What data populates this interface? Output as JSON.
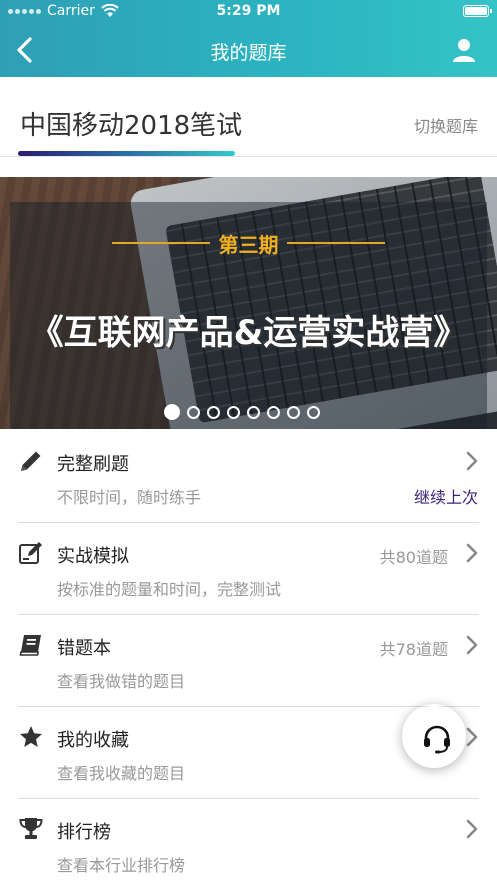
{
  "status_bar": {
    "carrier": "Carrier",
    "time": "5:29 PM"
  },
  "nav": {
    "title": "我的题库",
    "back_icon": "chevron-left-icon",
    "user_icon": "user-icon"
  },
  "bank": {
    "title": "中国移动2018笔试",
    "switch_label": "切换题库"
  },
  "banner": {
    "period": "第三期",
    "headline": "《互联网产品&运营实战营》",
    "page_count": 8,
    "active_page": 1
  },
  "menu": [
    {
      "name": "完整刷题",
      "desc": "不限时间，随时练手",
      "count": "",
      "extra": "继续上次",
      "icon": "pencil-icon"
    },
    {
      "name": "实战模拟",
      "desc": "按标准的题量和时间，完整测试",
      "count": "共80道题",
      "extra": "",
      "icon": "edit-note-icon"
    },
    {
      "name": "错题本",
      "desc": "查看我做错的题目",
      "count": "共78道题",
      "extra": "",
      "icon": "book-icon"
    },
    {
      "name": "我的收藏",
      "desc": "查看我收藏的题目",
      "count": "共",
      "extra": "",
      "icon": "star-icon"
    },
    {
      "name": "排行榜",
      "desc": "查看本行业排行榜",
      "count": "",
      "extra": "",
      "icon": "trophy-icon"
    }
  ],
  "colors": {
    "accent": "#2bb3c0",
    "extra_link": "#3d237a"
  },
  "fab": {
    "icon": "headset-icon"
  }
}
